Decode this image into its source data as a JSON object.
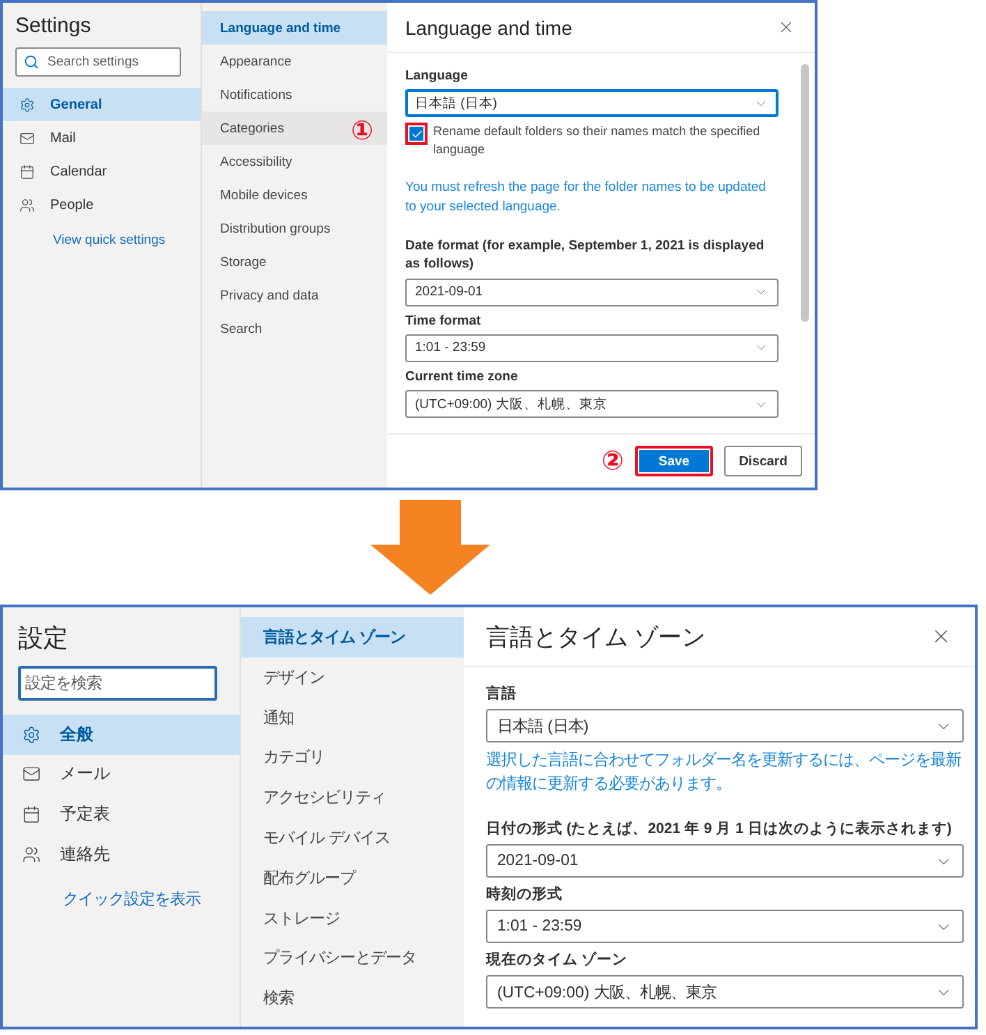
{
  "screenshots": [
    {
      "title": "Settings",
      "search": {
        "placeholder": "Search settings",
        "focused": false
      },
      "nav": [
        {
          "label": "General",
          "selected": true
        },
        {
          "label": "Mail",
          "selected": false
        },
        {
          "label": "Calendar",
          "selected": false
        },
        {
          "label": "People",
          "selected": false
        }
      ],
      "quick_link": "View quick settings",
      "categories": [
        {
          "label": "Language and time",
          "selected": true,
          "hovered": false
        },
        {
          "label": "Appearance",
          "selected": false,
          "hovered": false
        },
        {
          "label": "Notifications",
          "selected": false,
          "hovered": false
        },
        {
          "label": "Categories",
          "selected": false,
          "hovered": true
        },
        {
          "label": "Accessibility",
          "selected": false,
          "hovered": false
        },
        {
          "label": "Mobile devices",
          "selected": false,
          "hovered": false
        },
        {
          "label": "Distribution groups",
          "selected": false,
          "hovered": false
        },
        {
          "label": "Storage",
          "selected": false,
          "hovered": false
        },
        {
          "label": "Privacy and data",
          "selected": false,
          "hovered": false
        },
        {
          "label": "Search",
          "selected": false,
          "hovered": false
        }
      ],
      "pane": {
        "title": "Language and time",
        "language": {
          "label": "Language",
          "value": "日本語 (日本)"
        },
        "rename_checkbox": {
          "label": "Rename default folders so their names match the specified language",
          "checked": true,
          "highlighted": true,
          "marker": "①"
        },
        "notice": "You must refresh the page for the folder names to be updated to your selected language.",
        "fields": [
          {
            "label": "Date format (for example, September 1, 2021 is displayed as follows)",
            "value": "2021-09-01"
          },
          {
            "label": "Time format",
            "value": "1:01 - 23:59"
          },
          {
            "label": "Current time zone",
            "value": "(UTC+09:00) 大阪、札幌、東京"
          }
        ],
        "button_marker": "②",
        "buttons": [
          {
            "label": "Save",
            "kind": "primary",
            "highlighted": true
          },
          {
            "label": "Discard",
            "kind": "secondary",
            "highlighted": false
          }
        ]
      }
    },
    {
      "title": "設定",
      "search": {
        "placeholder": "設定を検索",
        "focused": true
      },
      "nav": [
        {
          "label": "全般",
          "selected": true
        },
        {
          "label": "メール",
          "selected": false
        },
        {
          "label": "予定表",
          "selected": false
        },
        {
          "label": "連絡先",
          "selected": false
        }
      ],
      "quick_link": "クイック設定を表示",
      "categories": [
        {
          "label": "言語とタイム ゾーン",
          "selected": true,
          "hovered": false
        },
        {
          "label": "デザイン",
          "selected": false,
          "hovered": false
        },
        {
          "label": "通知",
          "selected": false,
          "hovered": false
        },
        {
          "label": "カテゴリ",
          "selected": false,
          "hovered": false
        },
        {
          "label": "アクセシビリティ",
          "selected": false,
          "hovered": false
        },
        {
          "label": "モバイル デバイス",
          "selected": false,
          "hovered": false
        },
        {
          "label": "配布グループ",
          "selected": false,
          "hovered": false
        },
        {
          "label": "ストレージ",
          "selected": false,
          "hovered": false
        },
        {
          "label": "プライバシーとデータ",
          "selected": false,
          "hovered": false
        },
        {
          "label": "検索",
          "selected": false,
          "hovered": false
        }
      ],
      "pane": {
        "title": "言語とタイム ゾーン",
        "language": {
          "label": "言語",
          "value": "日本語 (日本)"
        },
        "notice": "選択した言語に合わせてフォルダー名を更新するには、ページを最新の情報に更新する必要があります。",
        "fields": [
          {
            "label": "日付の形式 (たとえば、2021 年 9 月 1 日は次のように表示されます)",
            "value": "2021-09-01"
          },
          {
            "label": "時刻の形式",
            "value": "1:01 - 23:59"
          },
          {
            "label": "現在のタイム ゾーン",
            "value": "(UTC+09:00) 大阪、札幌、東京"
          }
        ]
      }
    }
  ]
}
